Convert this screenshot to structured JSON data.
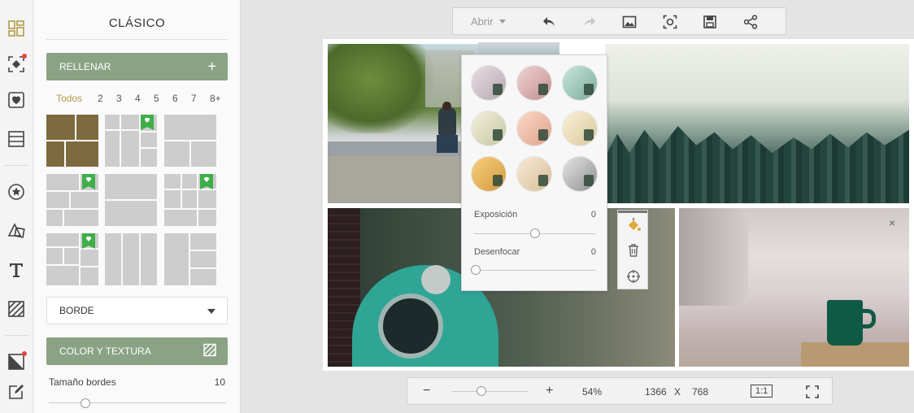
{
  "panel": {
    "title": "CLÁSICO",
    "fill_button": "RELLENAR",
    "fill_plus": "+",
    "filter_counts": [
      "Todos",
      "2",
      "3",
      "4",
      "5",
      "6",
      "7",
      "8+"
    ],
    "border_select": "BORDE",
    "color_texture_button": "COLOR Y TEXTURA",
    "border_size_label": "Tamaño bordes",
    "border_size_value": "10"
  },
  "toolbar": {
    "open_label": "Abrir"
  },
  "filter_popup": {
    "exposure_label": "Exposición",
    "exposure_value": "0",
    "blur_label": "Desenfocar",
    "blur_value": "0"
  },
  "bottom_bar": {
    "minus": "−",
    "plus": "+",
    "zoom": "54%",
    "width": "1366",
    "times": "X",
    "height": "768",
    "ratio_label": "1:1"
  },
  "photo_close": "×",
  "colors": {
    "accent_green": "#8aa384",
    "active_gold": "#b39a45",
    "premium_badge": "#3fae49",
    "notification": "#e84343"
  },
  "icons": [
    "layouts-icon",
    "design-elements-icon",
    "stickers-icon",
    "backgrounds-icon",
    "badges-icon",
    "shapes-icon",
    "text-icon",
    "texture-icon",
    "overlay-icon",
    "edit-icon",
    "undo-icon",
    "redo-icon",
    "image-icon",
    "screenshot-icon",
    "save-icon",
    "share-icon",
    "fill-bucket-icon",
    "delete-icon",
    "target-icon",
    "fullscreen-icon"
  ]
}
